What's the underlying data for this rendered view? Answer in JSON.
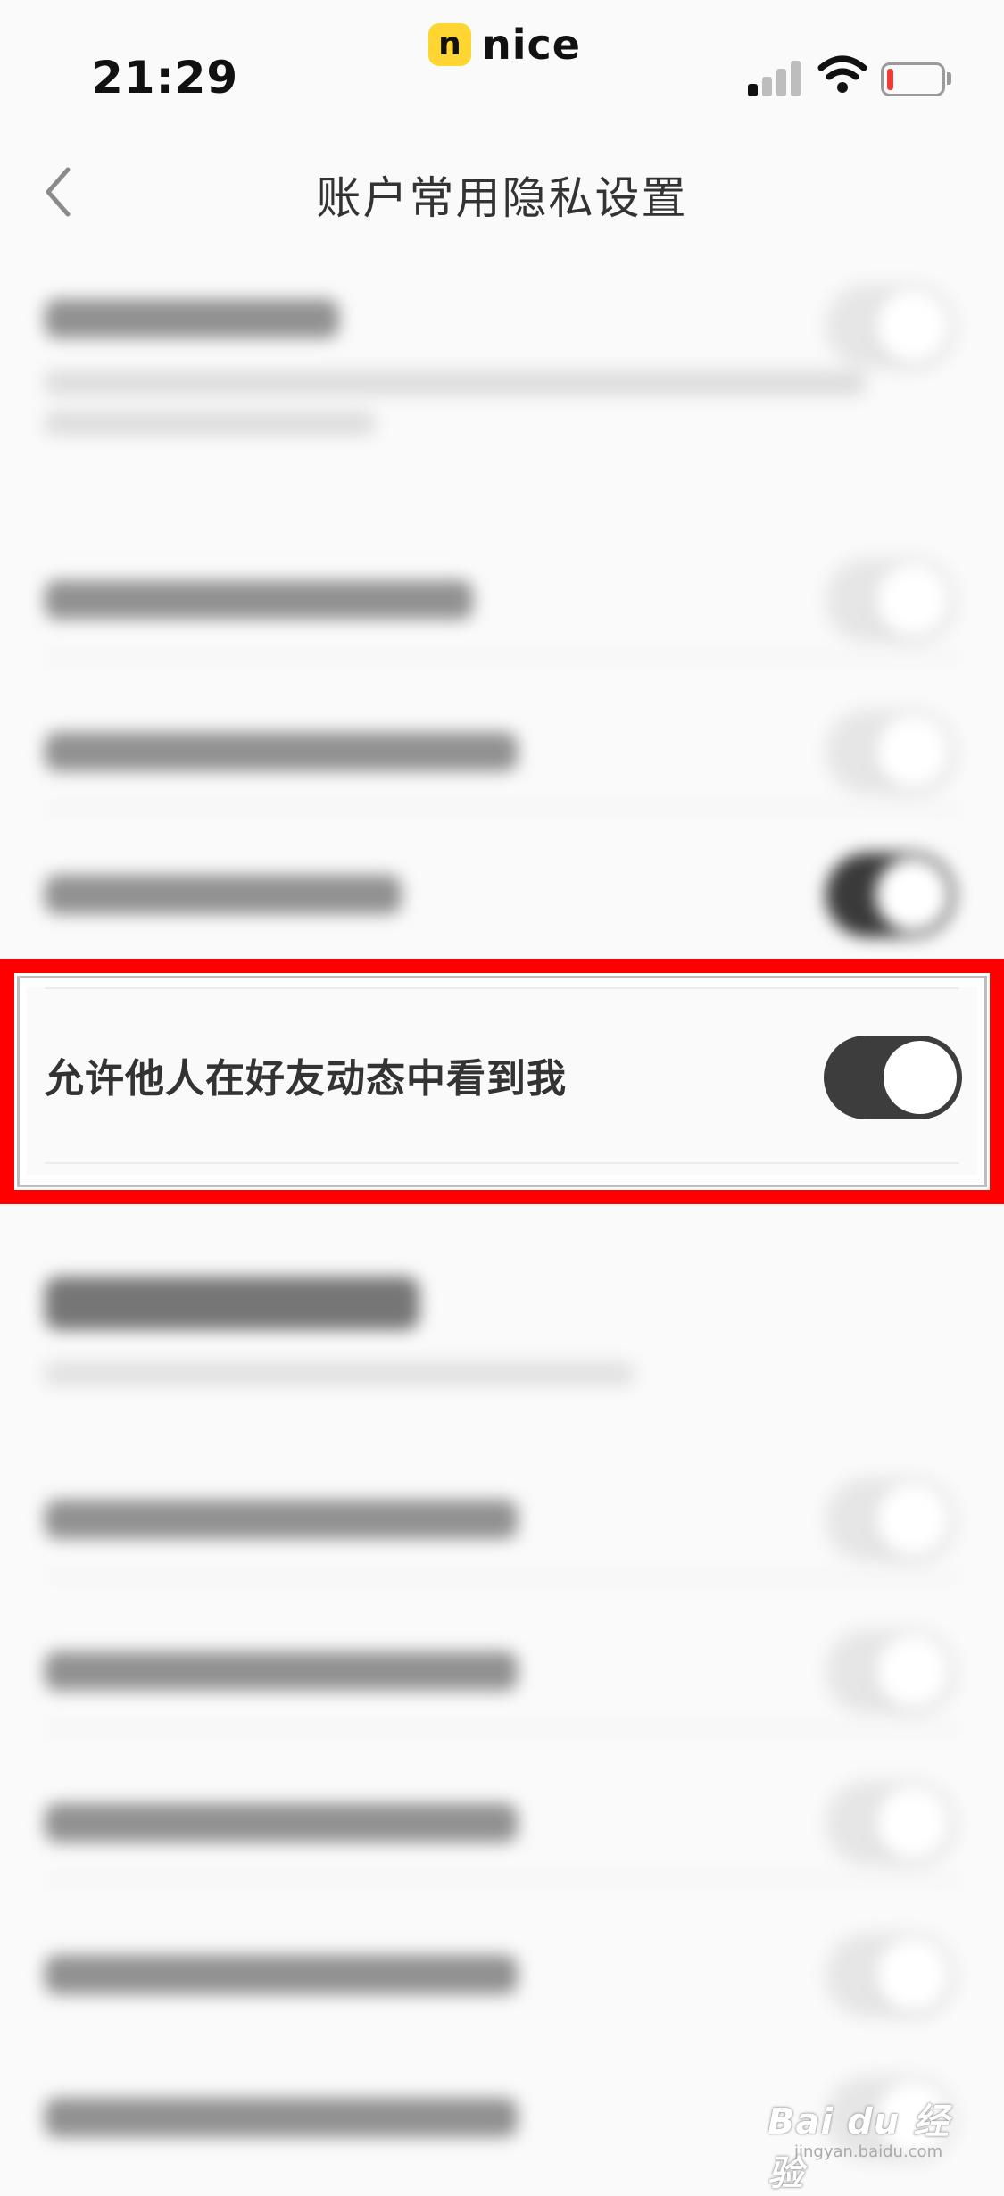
{
  "status_bar": {
    "time": "21:29",
    "brand_badge": "n",
    "brand_name": "nice",
    "battery_color": "#f03c35"
  },
  "nav": {
    "back_icon": "chevron-left-icon",
    "title": "账户常用隐私设置"
  },
  "highlighted_setting": {
    "label": "允许他人在好友动态中看到我",
    "toggle_on": true,
    "highlight_color": "#ff0000"
  },
  "watermark": {
    "text": "Bai du 经验",
    "sub": "jingyan.baidu.com"
  }
}
